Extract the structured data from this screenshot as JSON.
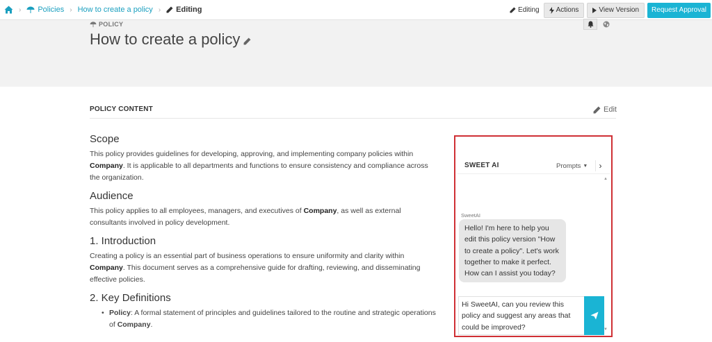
{
  "breadcrumb": {
    "items": [
      "Policies",
      "How to create a policy"
    ],
    "current": "Editing"
  },
  "toolbar": {
    "status": "Editing",
    "actions_label": "Actions",
    "view_version_label": "View Version",
    "request_approval_label": "Request Approval",
    "accent_color": "#1ab4d4"
  },
  "header": {
    "kicker": "POLICY",
    "title": "How to create a policy"
  },
  "section": {
    "label": "POLICY CONTENT",
    "edit_label": "Edit"
  },
  "content": {
    "scope_heading": "Scope",
    "scope_pre": "This policy provides guidelines for developing, approving, and implementing company policies within ",
    "scope_company": "Company",
    "scope_post": ". It is applicable to all departments and functions to ensure consistency and compliance across the organization.",
    "audience_heading": "Audience",
    "audience_pre": "This policy applies to all employees, managers, and executives of ",
    "audience_company": "Company",
    "audience_post": ", as well as external consultants involved in policy development.",
    "intro_heading": "1. Introduction",
    "intro_pre": "Creating a policy is an essential part of business operations to ensure uniformity and clarity within ",
    "intro_company": "Company",
    "intro_post": ". This document serves as a comprehensive guide for drafting, reviewing, and disseminating effective policies.",
    "defs_heading": "2. Key Definitions",
    "def_term": "Policy",
    "def_pre": ": A formal statement of principles and guidelines tailored to the routine and strategic operations of ",
    "def_company": "Company",
    "def_post": "."
  },
  "ai_panel": {
    "title": "SWEET AI",
    "prompts_label": "Prompts",
    "sender": "SweetAI",
    "message": "Hello! I'm here to help you edit this policy version \"How to create a policy\". Let's work together to make it perfect. How can I assist you today?",
    "input_value": "Hi SweetAI, can you review this policy and suggest any areas that could be improved?",
    "highlight_color": "#cf2f34"
  }
}
